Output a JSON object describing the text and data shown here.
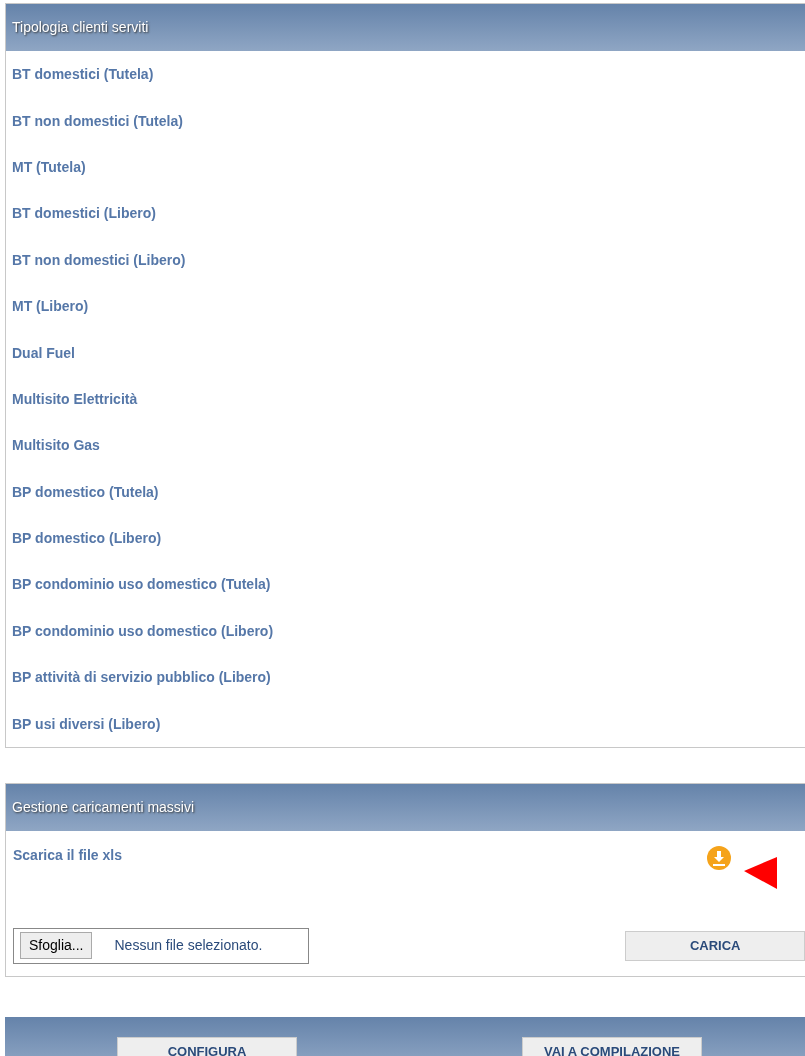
{
  "clients_panel": {
    "title": "Tipologia clienti serviti",
    "items": [
      "BT domestici (Tutela)",
      "BT non domestici (Tutela)",
      "MT (Tutela)",
      "BT domestici (Libero)",
      "BT non domestici (Libero)",
      "MT (Libero)",
      "Dual Fuel",
      "Multisito Elettricità",
      "Multisito Gas",
      "BP domestico (Tutela)",
      "BP domestico (Libero)",
      "BP condominio uso domestico (Tutela)",
      "BP condominio uso domestico (Libero)",
      "BP attività di servizio pubblico (Libero)",
      "BP usi diversi (Libero)"
    ]
  },
  "upload_panel": {
    "title": "Gestione caricamenti massivi",
    "download_label": "Scarica il file xls",
    "browse_button": "Sfoglia...",
    "file_status": "Nessun file selezionato.",
    "upload_button": "CARICA"
  },
  "footer": {
    "buttons": [
      "CONFIGURA",
      "VAI A COMPILAZIONE"
    ]
  }
}
